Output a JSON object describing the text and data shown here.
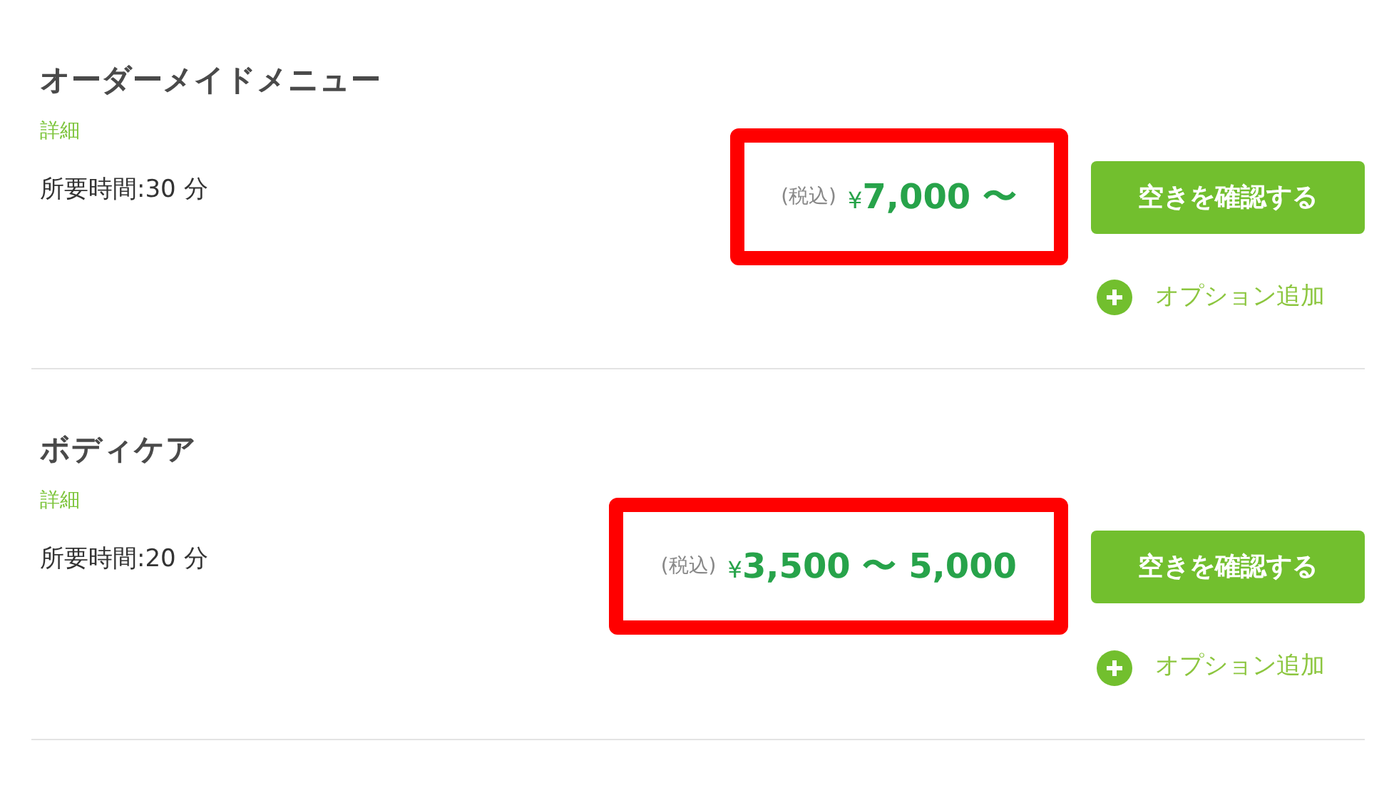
{
  "menu_items": [
    {
      "title": "オーダーメイドメニュー",
      "detail_link": "詳細",
      "duration": "所要時間:30 分",
      "tax_label": "(税込)",
      "currency": "¥",
      "amount": "7,000 〜",
      "highlighted": true,
      "button": "空きを確認する",
      "option_link": "オプション追加"
    },
    {
      "title": "ボディケア",
      "detail_link": "詳細",
      "duration": "所要時間:20 分",
      "tax_label": "(税込)",
      "currency": "¥",
      "amount": "3,500 〜 5,000",
      "highlighted": true,
      "button": "空きを確認する",
      "option_link": "オプション追加"
    }
  ]
}
